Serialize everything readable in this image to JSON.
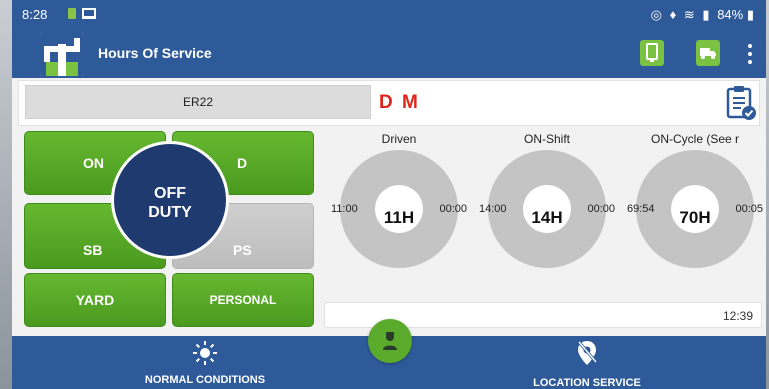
{
  "status_bar": {
    "time": "8:28",
    "battery": "84%"
  },
  "app_bar": {
    "title": "Hours Of Service",
    "device_icon": "device-phone-icon",
    "truck_icon": "truck-icon",
    "menu_icon": "more-vert-icon"
  },
  "vehicle": {
    "unit": "ER22",
    "dm_indicator": "D M"
  },
  "duty_status": {
    "current_line1": "OFF",
    "current_line2": "DUTY",
    "buttons": {
      "on": "ON",
      "d": "D",
      "sb": "SB",
      "ps": "PS",
      "yard": "YARD",
      "personal": "PERSONAL"
    }
  },
  "clocks": [
    {
      "label": "Driven",
      "value": "11H",
      "left": "11:00",
      "right": "00:00"
    },
    {
      "label": "ON-Shift",
      "value": "14H",
      "left": "14:00",
      "right": "00:00"
    },
    {
      "label": "ON-Cycle (See r",
      "value": "70H",
      "left": "69:54",
      "right": "00:05"
    }
  ],
  "current_time": "12:39",
  "bottom_nav": {
    "conditions": "NORMAL CONDITIONS",
    "location": "LOCATION SERVICE"
  },
  "colors": {
    "brand_blue": "#2f5a9a",
    "status_green": "#5aab2c",
    "current_status_navy": "#1e3a6e",
    "dm_red": "#e0241c"
  }
}
